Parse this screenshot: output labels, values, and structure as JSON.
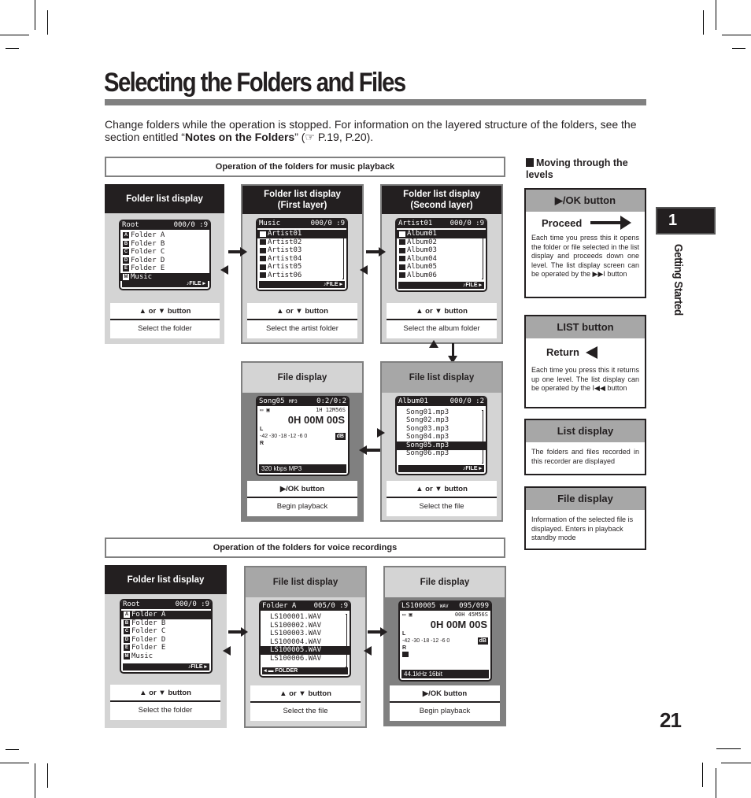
{
  "page": {
    "title": "Selecting the Folders and Files",
    "intro_part1": "Change folders while the operation is stopped. For information on the layered structure of the folders, see the section entitled “",
    "intro_bold": "Notes on the Folders",
    "intro_part2": "” (☞ P.19, P.20).",
    "chapter_number": "1",
    "chapter_label": "Getting Started",
    "page_number": "21"
  },
  "music": {
    "section_title": "Operation of the folders for music playback",
    "panels": [
      {
        "header": "Folder list display",
        "screen": {
          "head_left": "Root",
          "head_right": "000/0 :9",
          "rows": [
            {
              "icon": "A",
              "label": "Folder A",
              "selected": false
            },
            {
              "icon": "B",
              "label": "Folder B",
              "selected": false
            },
            {
              "icon": "C",
              "label": "Folder C",
              "selected": false
            },
            {
              "icon": "D",
              "label": "Folder D",
              "selected": false
            },
            {
              "icon": "E",
              "label": "Folder E",
              "selected": false
            },
            {
              "icon": "M",
              "label": "Music",
              "selected": true
            }
          ],
          "footer": "♪FILE ▸"
        },
        "button": "▲ or ▼ button",
        "action": "Select the folder"
      },
      {
        "header": "Folder list display\n(First layer)",
        "header_line1": "Folder list display",
        "header_line2": "(First layer)",
        "screen": {
          "head_left": "Music",
          "head_right": "000/0 :9",
          "rows": [
            {
              "label": "Artist01",
              "selected": true
            },
            {
              "label": "Artist02",
              "selected": false
            },
            {
              "label": "Artist03",
              "selected": false
            },
            {
              "label": "Artist04",
              "selected": false
            },
            {
              "label": "Artist05",
              "selected": false
            },
            {
              "label": "Artist06",
              "selected": false
            }
          ],
          "footer": "♪FILE ▸"
        },
        "button": "▲ or ▼ button",
        "action": "Select the artist folder"
      },
      {
        "header_line1": "Folder list display",
        "header_line2": "(Second layer)",
        "screen": {
          "head_left": "Artist01",
          "head_right": "000/0 :9",
          "rows": [
            {
              "label": "Album01",
              "selected": true
            },
            {
              "label": "Album02",
              "selected": false
            },
            {
              "label": "Album03",
              "selected": false
            },
            {
              "label": "Album04",
              "selected": false
            },
            {
              "label": "Album05",
              "selected": false
            },
            {
              "label": "Album06",
              "selected": false
            }
          ],
          "footer": "♪FILE ▸"
        },
        "button": "▲ or ▼ button",
        "action": "Select the album folder"
      }
    ],
    "file_display": {
      "header": "File display",
      "screen": {
        "head_left": "Song05",
        "head_badge": "MP3",
        "head_right": "0:2/0:2",
        "remaining": "1H 12M56S",
        "time": "0H 00M 00S",
        "meter_l": "L",
        "meter_scale": "-42 -30 -18   -12   -6   0",
        "meter_unit": "dB",
        "meter_r": "R",
        "footer": "320 kbps  MP3"
      },
      "button": "▶/OK button",
      "action": "Begin playback"
    },
    "file_list_display": {
      "header": "File list display",
      "screen": {
        "head_left": "Album01",
        "head_right": "000/0 :2",
        "rows": [
          {
            "label": "Song01.mp3",
            "selected": false
          },
          {
            "label": "Song02.mp3",
            "selected": false
          },
          {
            "label": "Song03.mp3",
            "selected": false
          },
          {
            "label": "Song04.mp3",
            "selected": false
          },
          {
            "label": "Song05.mp3",
            "selected": true
          },
          {
            "label": "Song06.mp3",
            "selected": false
          }
        ],
        "footer": "♪FILE ▸"
      },
      "button": "▲ or ▼ button",
      "action": "Select the file"
    }
  },
  "voice": {
    "section_title": "Operation of the folders for voice recordings",
    "folder_list": {
      "header": "Folder list display",
      "screen": {
        "head_left": "Root",
        "head_right": "000/0 :9",
        "rows": [
          {
            "icon": "A",
            "label": "Folder A",
            "selected": true
          },
          {
            "icon": "B",
            "label": "Folder B",
            "selected": false
          },
          {
            "icon": "C",
            "label": "Folder C",
            "selected": false
          },
          {
            "icon": "D",
            "label": "Folder D",
            "selected": false
          },
          {
            "icon": "E",
            "label": "Folder E",
            "selected": false
          },
          {
            "icon": "M",
            "label": "Music",
            "selected": false
          }
        ],
        "footer": "♪FILE ▸"
      },
      "button": "▲ or ▼ button",
      "action": "Select the folder"
    },
    "file_list": {
      "header": "File list display",
      "screen": {
        "head_left": "Folder A",
        "head_right": "005/0 :9",
        "rows": [
          {
            "label": "LS100001.WAV",
            "selected": false
          },
          {
            "label": "LS100002.WAV",
            "selected": false
          },
          {
            "label": "LS100003.WAV",
            "selected": false
          },
          {
            "label": "LS100004.WAV",
            "selected": false
          },
          {
            "label": "LS100005.WAV",
            "selected": true
          },
          {
            "label": "LS100006.WAV",
            "selected": false
          }
        ],
        "footer": "◂ ▬ FOLDER"
      },
      "button": "▲ or ▼ button",
      "action": "Select the file"
    },
    "file_display": {
      "header": "File display",
      "screen": {
        "head_left": "LS100005",
        "head_badge": "WAV",
        "head_right": "095/099",
        "remaining": "00H 45M56S",
        "time": "0H 00M 00S",
        "meter_l": "L",
        "meter_scale": "-42 -30 -18   -12   -6   0",
        "meter_unit": "dB",
        "meter_r": "R",
        "footer": "44.1kHz  16bit"
      },
      "button": "▶/OK button",
      "action": "Begin playback"
    }
  },
  "sidebar": {
    "heading": "Moving through the levels",
    "boxes": [
      {
        "title": "▶/OK button",
        "subtitle": "Proceed",
        "text": "Each time you press this it opens the folder or file selected in the list display and proceeds down one level. The list display screen can be operated by the ▶▶I button"
      },
      {
        "title": "LIST button",
        "subtitle": "Return",
        "text": "Each time you press this it returns up one level. The list display can be operated by the I◀◀ button"
      },
      {
        "title": "List display",
        "text": "The folders and files recorded in this recorder are displayed"
      },
      {
        "title": "File display",
        "text": "Information of the selected file is displayed. Enters in playback standby mode"
      }
    ]
  },
  "colors": {
    "dark": "#231f20",
    "mid_gray": "#a7a7a7",
    "light_gray": "#d4d4d4",
    "panel_dark": "#808080"
  }
}
